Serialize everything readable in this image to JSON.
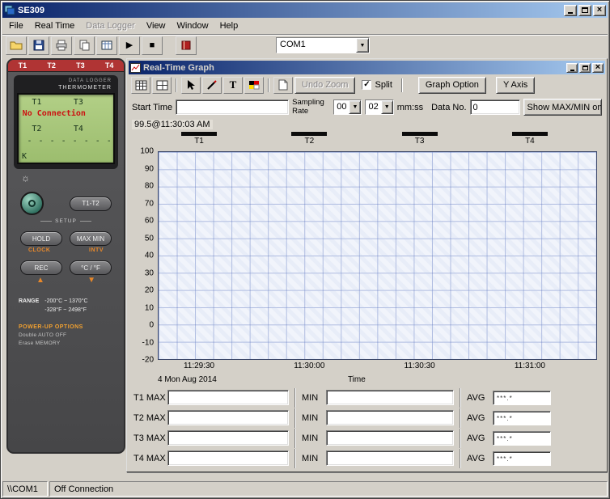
{
  "window": {
    "title": "SE309",
    "menu": [
      {
        "label": "File",
        "enabled": true
      },
      {
        "label": "Real Time",
        "enabled": true
      },
      {
        "label": "Data Logger",
        "enabled": false
      },
      {
        "label": "View",
        "enabled": true
      },
      {
        "label": "Window",
        "enabled": true
      },
      {
        "label": "Help",
        "enabled": true
      }
    ],
    "com_select": "COM1"
  },
  "device": {
    "inputs": [
      "T1",
      "T2",
      "T3",
      "T4"
    ],
    "label_line1": "DATA LOGGER",
    "label_line2": "THERMOMETER",
    "lcd": {
      "t1": "T1",
      "t3": "T3",
      "status": "No Connection",
      "t2": "T2",
      "t4": "T4",
      "dashes": "- - - -   - - - -",
      "type": "K"
    },
    "buttons": {
      "t1t2": "T1-T2",
      "setup": "SETUP",
      "hold": "HOLD",
      "maxmin": "MAX MIN",
      "clock": "CLOCK",
      "intv": "INTV",
      "rec": "REC",
      "cf": "°C / °F"
    },
    "range_label": "RANGE",
    "range_c": "-200°C ~ 1370°C",
    "range_f": "-328°F ~ 2498°F",
    "powerup_title": "POWER-UP  OPTIONS",
    "powerup_1": "Double AUTO OFF",
    "powerup_2": "Erase MEMORY"
  },
  "graph_window": {
    "title": "Real-Time Graph",
    "undo_zoom": "Undo Zoom",
    "split_label": "Split",
    "split_checked": true,
    "graph_option": "Graph Option",
    "y_axis": "Y Axis",
    "start_time_label": "Start Time",
    "start_time_value": "",
    "sampling_rate_label": "Sampling Rate",
    "rate_min": "00",
    "rate_sec": "02",
    "rate_unit": "mm:ss",
    "data_no_label": "Data No.",
    "data_no_value": "0",
    "show_maxmin": "Show MAX/MIN on"
  },
  "chart_data": {
    "type": "line",
    "xlabel": "Time",
    "date_label": "4 Mon Aug 2014",
    "annotations": [
      "99.5@11:30:03 AM"
    ],
    "ylim": [
      -20,
      100
    ],
    "yticks": [
      100,
      90,
      80,
      70,
      60,
      50,
      40,
      30,
      20,
      10,
      0,
      -10,
      -20
    ],
    "xticks": [
      "11:29:30",
      "11:30:00",
      "11:30:30",
      "11:31:00"
    ],
    "grid": true,
    "legend_position": "top",
    "series": [
      {
        "name": "T1",
        "values": []
      },
      {
        "name": "T2",
        "values": []
      },
      {
        "name": "T3",
        "values": []
      },
      {
        "name": "T4",
        "values": []
      }
    ]
  },
  "stats": {
    "min_label": "MIN",
    "avg_label": "AVG",
    "rows": [
      {
        "channel": "T1",
        "max_label": "T1 MAX",
        "max": "",
        "min": "",
        "avg": "***.*"
      },
      {
        "channel": "T2",
        "max_label": "T2 MAX",
        "max": "",
        "min": "",
        "avg": "***.*"
      },
      {
        "channel": "T3",
        "max_label": "T3 MAX",
        "max": "",
        "min": "",
        "avg": "***.*"
      },
      {
        "channel": "T4",
        "max_label": "T4 MAX",
        "max": "",
        "min": "",
        "avg": "***.*"
      }
    ]
  },
  "statusbar": {
    "port": "\\\\COM1",
    "status": "Off Connection"
  }
}
